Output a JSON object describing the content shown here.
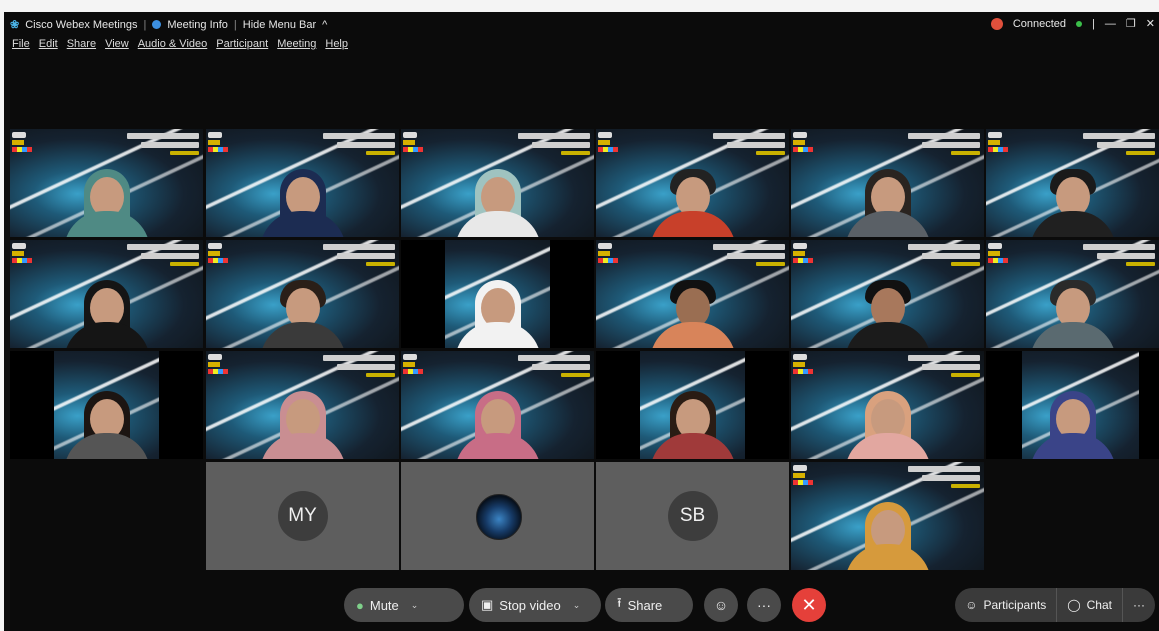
{
  "titlebar": {
    "app_name": "Cisco Webex Meetings",
    "meeting_info": "Meeting Info",
    "hide_menu_bar": "Hide Menu Bar",
    "hide_chevron": "^",
    "connection_status": "Connected",
    "minimize": "—",
    "restore": "❐",
    "close": "✕",
    "separator": "|"
  },
  "menu": [
    "File",
    "Edit",
    "Share",
    "View",
    "Audio & Video",
    "Participant",
    "Meeting",
    "Help"
  ],
  "avatars": {
    "my": "MY",
    "sb": "SB"
  },
  "controls": {
    "mute": "Mute",
    "stop_video": "Stop video",
    "share": "Share",
    "reactions_icon": "☺",
    "more_icon": "···",
    "end_icon": "✕",
    "participants": "Participants",
    "chat": "Chat",
    "overflow": "···",
    "chevron": "⌄",
    "mic_icon": "🎙",
    "camera_icon": "▣",
    "share_icon": "⭱",
    "participants_icon": "☺",
    "chat_icon": "◯"
  },
  "colors": {
    "accent_border": "#34b6e0",
    "end_button": "#e5403a",
    "connected_dot": "#3bbf4a",
    "status_badge": "#e0503c"
  }
}
